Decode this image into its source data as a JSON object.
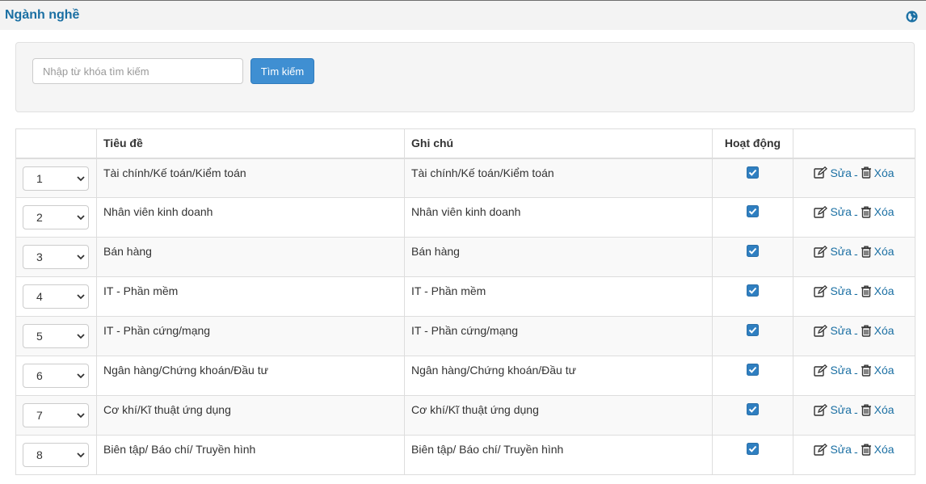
{
  "header": {
    "title": "Ngành nghề",
    "icon": "globe-icon"
  },
  "search": {
    "placeholder": "Nhập từ khóa tìm kiếm",
    "value": "",
    "button_label": "Tìm kiếm"
  },
  "table": {
    "columns": [
      "",
      "Tiêu đề",
      "Ghi chú",
      "Hoạt động",
      ""
    ],
    "edit_label": "Sửa",
    "separator": "-",
    "delete_label": "Xóa",
    "rows": [
      {
        "order": "1",
        "title": "Tài chính/Kế toán/Kiểm toán",
        "note": "Tài chính/Kế toán/Kiểm toán",
        "active": true
      },
      {
        "order": "2",
        "title": "Nhân viên kinh doanh",
        "note": "Nhân viên kinh doanh",
        "active": true
      },
      {
        "order": "3",
        "title": "Bán hàng",
        "note": "Bán hàng",
        "active": true
      },
      {
        "order": "4",
        "title": "IT - Phần mềm",
        "note": "IT - Phần mềm",
        "active": true
      },
      {
        "order": "5",
        "title": "IT - Phần cứng/mạng",
        "note": "IT - Phần cứng/mạng",
        "active": true
      },
      {
        "order": "6",
        "title": "Ngân hàng/Chứng khoán/Đầu tư",
        "note": "Ngân hàng/Chứng khoán/Đầu tư",
        "active": true
      },
      {
        "order": "7",
        "title": "Cơ khí/Kĩ thuật ứng dụng",
        "note": "Cơ khí/Kĩ thuật ứng dụng",
        "active": true
      },
      {
        "order": "8",
        "title": "Biên tập/ Báo chí/ Truyền hình",
        "note": "Biên tập/ Báo chí/ Truyền hình",
        "active": true
      }
    ]
  },
  "colors": {
    "accent": "#1a6fa3",
    "button": "#3f8fd2",
    "checkbox": "#2f7fc1"
  }
}
